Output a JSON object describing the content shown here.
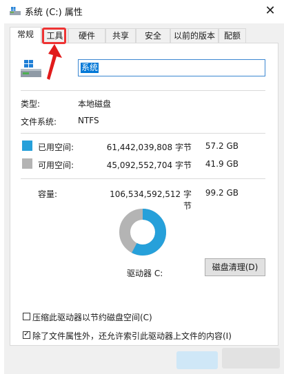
{
  "window": {
    "title": "系统 (C:) 属性",
    "close_glyph": "✕"
  },
  "tabs": [
    "常规",
    "工具",
    "硬件",
    "共享",
    "安全",
    "以前的版本",
    "配额"
  ],
  "drive": {
    "name": "系统",
    "type_label": "类型:",
    "type_value": "本地磁盘",
    "fs_label": "文件系统:",
    "fs_value": "NTFS"
  },
  "space": {
    "used_label": "已用空间:",
    "used_bytes": "61,442,039,808 字节",
    "used_gb": "57.2 GB",
    "used_color": "#26a0da",
    "free_label": "可用空间:",
    "free_bytes": "45,092,552,704 字节",
    "free_gb": "41.9 GB",
    "free_color": "#b4b4b4",
    "capacity_label": "容量:",
    "capacity_bytes": "106,534,592,512 字节",
    "capacity_gb": "99.2 GB",
    "used_fraction": 0.5767
  },
  "drive_label": "驱动器 C:",
  "cleanup_button": "磁盘清理(D)",
  "options": {
    "compress_label": "压缩此驱动器以节约磁盘空间(C)",
    "compress_checked": false,
    "index_label": "除了文件属性外，还允许索引此驱动器上文件的内容(I)",
    "index_checked": true
  }
}
